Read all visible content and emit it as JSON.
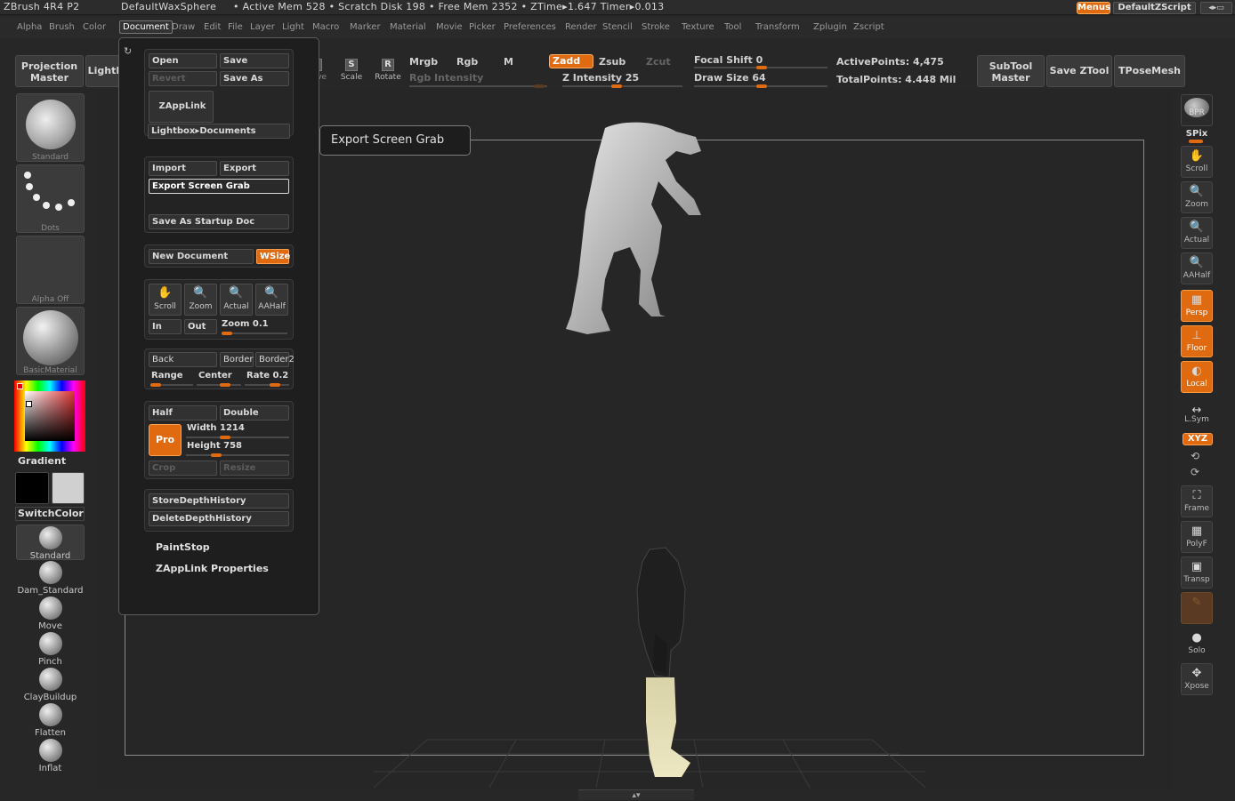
{
  "titlebar": {
    "app": "ZBrush 4R4 P2",
    "doc": "DefaultWaxSphere",
    "mem": "• Active Mem 528 • Scratch Disk 198 • Free Mem 2352 • ZTime▸1.647 Timer▸0.013",
    "menus_btn": "Menus",
    "zscript": "DefaultZScript"
  },
  "menubar": [
    "Alpha",
    "Brush",
    "Color",
    "Document",
    "Draw",
    "Edit",
    "File",
    "Layer",
    "Light",
    "Macro",
    "Marker",
    "Material",
    "Movie",
    "Picker",
    "Preferences",
    "Render",
    "Stencil",
    "Stroke",
    "Texture",
    "Tool",
    "Transform",
    "Zplugin",
    "Zscript"
  ],
  "shelf": {
    "projection_master": "Projection Master",
    "lightbox": "LightBox",
    "move": "Move",
    "scale": "Scale",
    "rotate": "Rotate",
    "move_letter": "M",
    "scale_letter": "S",
    "rotate_letter": "R",
    "mrgb": "Mrgb",
    "rgb": "Rgb",
    "m": "M",
    "zadd": "Zadd",
    "zsub": "Zsub",
    "zcut": "Zcut",
    "rgb_intensity": "Rgb Intensity",
    "z_intensity_label": "Z Intensity",
    "z_intensity": "25",
    "focal_shift_label": "Focal Shift",
    "focal_shift": "0",
    "draw_size_label": "Draw Size",
    "draw_size": "64",
    "active_points": "ActivePoints: 4,475",
    "total_points": "TotalPoints: 4.448 Mil",
    "subtool_master": "SubTool Master",
    "save_ztool": "Save ZTool",
    "tpose_mesh": "TPoseMesh"
  },
  "left": {
    "standard": "Standard",
    "dots": "Dots",
    "alpha_off": "Alpha Off",
    "basic_material": "BasicMaterial",
    "gradient": "Gradient",
    "switch_color": "SwitchColor",
    "brushes": [
      "Standard",
      "Dam_Standard",
      "Move",
      "Pinch",
      "ClayBuildup",
      "Flatten",
      "Inflat"
    ]
  },
  "document_menu": {
    "open": "Open",
    "save": "Save",
    "revert": "Revert",
    "save_as": "Save As",
    "zapplink": "ZAppLink",
    "lightbox_docs": "Lightbox▸Documents",
    "import": "Import",
    "export": "Export",
    "export_screen_grab": "Export Screen Grab",
    "save_startup": "Save As Startup Doc",
    "new_document": "New Document",
    "wsize": "WSize",
    "scroll": "Scroll",
    "zoom": "Zoom",
    "actual": "Actual",
    "aahalf": "AAHalf",
    "in": "In",
    "out": "Out",
    "zoom_label": "Zoom",
    "zoom_val": "0.1",
    "back": "Back",
    "border": "Border",
    "border2": "Border2",
    "range": "Range",
    "center": "Center",
    "rate_label": "Rate",
    "rate_val": "0.2",
    "half": "Half",
    "double": "Double",
    "pro": "Pro",
    "width_label": "Width",
    "width_val": "1214",
    "height_label": "Height",
    "height_val": "758",
    "crop": "Crop",
    "resize": "Resize",
    "store_depth": "StoreDepthHistory",
    "delete_depth": "DeleteDepthHistory",
    "paintstop": "PaintStop",
    "zapplink_props": "ZAppLink Properties"
  },
  "tooltip": "Export Screen Grab",
  "right": {
    "bpr": "BPR",
    "spix": "SPix",
    "scroll": "Scroll",
    "zoom": "Zoom",
    "actual": "Actual",
    "aahalf": "AAHalf",
    "persp": "Persp",
    "floor": "Floor",
    "local": "Local",
    "lsym": "L.Sym",
    "xyz": "XYZ",
    "frame": "Frame",
    "polyf": "PolyF",
    "transp": "Transp",
    "solo": "Solo",
    "xpose": "Xpose"
  },
  "colors": {
    "accent": "#e06a10",
    "bg": "#272727"
  }
}
